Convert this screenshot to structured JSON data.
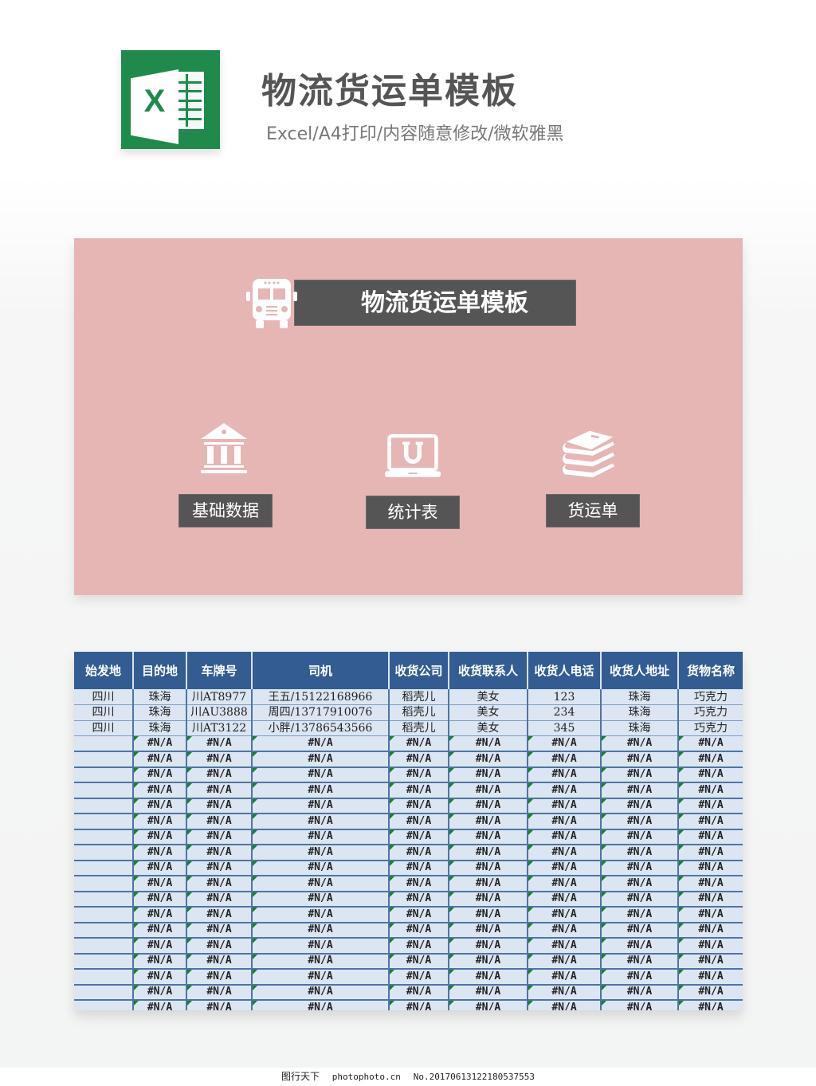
{
  "header": {
    "title": "物流货运单模板",
    "subtitle": "Excel/A4打印/内容随意修改/微软雅黑",
    "logo_letter": "X",
    "brand_color": "#1f8a4c"
  },
  "dashboard": {
    "background_color": "#e6b6b5",
    "banner_title": "物流货运单模板",
    "nav": [
      {
        "label": "基础数据",
        "icon": "bank-building-icon"
      },
      {
        "label": "统计表",
        "icon": "laptop-u-icon"
      },
      {
        "label": "货运单",
        "icon": "books-stack-icon"
      }
    ]
  },
  "table": {
    "header_color": "#335d92",
    "columns": [
      "始发地",
      "目的地",
      "车牌号",
      "司机",
      "收货公司",
      "收货联系人",
      "收货人电话",
      "收货人地址",
      "货物名称"
    ],
    "rows": [
      [
        "四川",
        "珠海",
        "川AT8977",
        "王五/15122168966",
        "稻壳儿",
        "美女",
        "123",
        "珠海",
        "巧克力"
      ],
      [
        "四川",
        "珠海",
        "川AU3888",
        "周四/13717910076",
        "稻壳儿",
        "美女",
        "234",
        "珠海",
        "巧克力"
      ],
      [
        "四川",
        "珠海",
        "川AT3122",
        "小胖/13786543566",
        "稻壳儿",
        "美女",
        "345",
        "珠海",
        "巧克力"
      ]
    ],
    "error_value": "#N/A",
    "error_row_count": 18
  },
  "footer": {
    "brand": "图行天下",
    "site": "photophoto.cn",
    "number": "No.20170613122180537553"
  }
}
